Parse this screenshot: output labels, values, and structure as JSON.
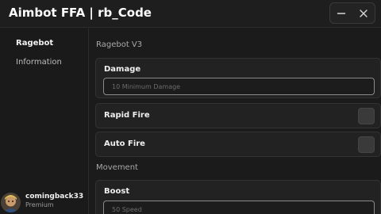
{
  "window": {
    "title": "Aimbot FFA | rb_Code",
    "minimize_icon": "minimize-icon",
    "close_icon": "close-icon"
  },
  "sidebar": {
    "items": [
      {
        "label": "Ragebot",
        "active": true
      },
      {
        "label": "Information",
        "active": false
      }
    ]
  },
  "profile": {
    "username": "comingback33",
    "tier": "Premium",
    "avatar_icon": "avatar"
  },
  "main": {
    "section_ragebot": "Ragebot V3",
    "damage": {
      "label": "Damage",
      "placeholder": "10 Minimum Damage",
      "value": ""
    },
    "rapid_fire": {
      "label": "Rapid Fire",
      "checked": false
    },
    "auto_fire": {
      "label": "Auto Fire",
      "checked": false
    },
    "section_movement": "Movement",
    "boost": {
      "label": "Boost",
      "placeholder": "50 Speed",
      "value": ""
    }
  },
  "colors": {
    "background": "#1b1b1b",
    "card": "#222222",
    "input_border": "#8a8a8a",
    "checkbox": "#3a3a3a"
  }
}
